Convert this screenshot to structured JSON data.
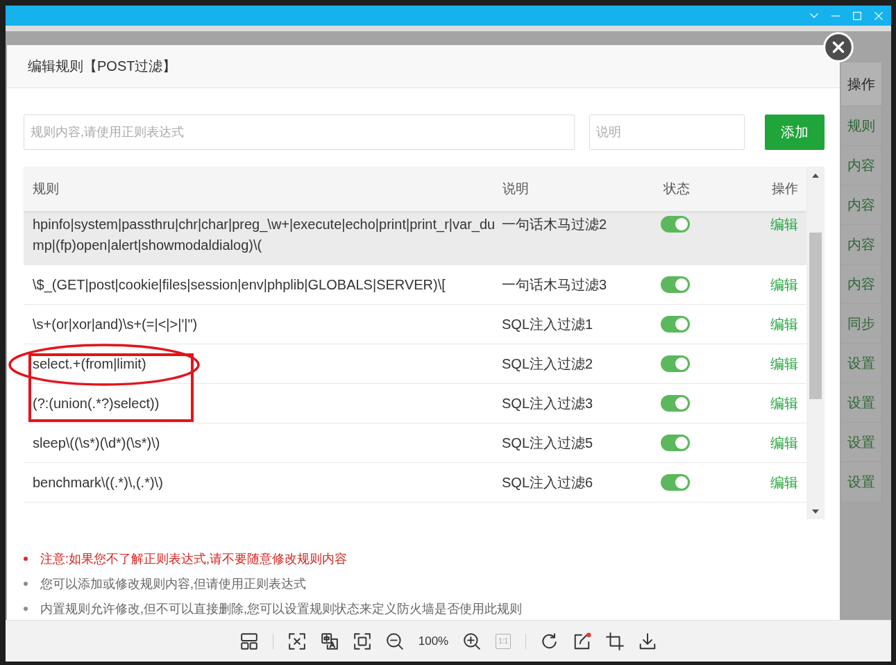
{
  "background_page": {
    "column_header": "操作",
    "cells": [
      "规则",
      "内容",
      "内容",
      "内容",
      "内容",
      "同步",
      "设置",
      "设置",
      "设置",
      "设置"
    ]
  },
  "dialog": {
    "title": "编辑规则【POST过滤】",
    "rule_input": {
      "placeholder": "规则内容,请使用正则表达式"
    },
    "description_input": {
      "placeholder": "说明"
    },
    "add_button": "添加",
    "table": {
      "columns": [
        "规则",
        "说明",
        "状态",
        "操作"
      ],
      "rows": [
        {
          "rule": "hpinfo|system|passthru|chr|char|preg_\\w+|execute|echo|print|print_r|var_dump|(fp)open|alert|showmodaldialog)\\(",
          "description": "一句话木马过滤2",
          "enabled": true,
          "action": "编辑",
          "highlighted": true
        },
        {
          "rule": "\\$_(GET|post|cookie|files|session|env|phplib|GLOBALS|SERVER)\\[",
          "description": "一句话木马过滤3",
          "enabled": true,
          "action": "编辑",
          "highlighted": false
        },
        {
          "rule": "\\s+(or|xor|and)\\s+(=|<|>|'|\")",
          "description": "SQL注入过滤1",
          "enabled": true,
          "action": "编辑",
          "highlighted": false
        },
        {
          "rule": "select.+(from|limit)",
          "description": "SQL注入过滤2",
          "enabled": true,
          "action": "编辑",
          "highlighted": false
        },
        {
          "rule": "(?:(union(.*?)select))",
          "description": "SQL注入过滤3",
          "enabled": true,
          "action": "编辑",
          "highlighted": false
        },
        {
          "rule": "sleep\\((\\s*)(\\d*)(\\s*)\\)",
          "description": "SQL注入过滤5",
          "enabled": true,
          "action": "编辑",
          "highlighted": false
        },
        {
          "rule": "benchmark\\((.*)\\,(.*)\\)",
          "description": "SQL注入过滤6",
          "enabled": true,
          "action": "编辑",
          "highlighted": false
        }
      ]
    },
    "notes": [
      {
        "kind": "warning",
        "text": "注意:如果您不了解正则表达式,请不要随意修改规则内容"
      },
      {
        "kind": "info",
        "text": "您可以添加或修改规则内容,但请使用正则表达式"
      },
      {
        "kind": "info",
        "text": "内置规则允许修改,但不可以直接删除,您可以设置规则状态来定义防火墙是否使用此规则"
      }
    ]
  },
  "annotations": [
    {
      "kind": "ellipse"
    },
    {
      "kind": "rectangle"
    }
  ],
  "toolbar": {
    "zoom_level": "100%",
    "actual_size": {
      "label": "1:1",
      "disabled": true
    }
  }
}
